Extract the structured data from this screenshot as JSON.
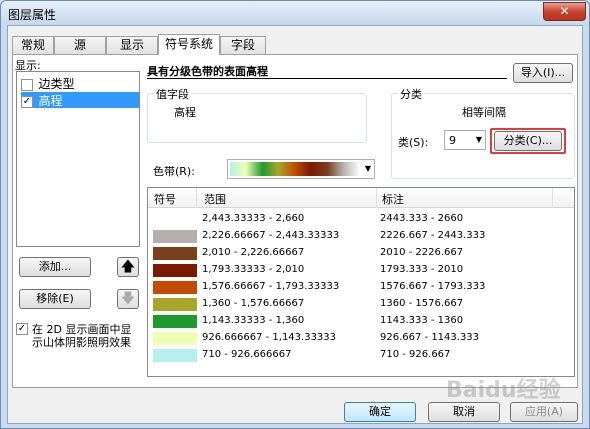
{
  "window": {
    "title": "图层属性",
    "close_glyph": "✕"
  },
  "tabs": [
    {
      "label": "常规"
    },
    {
      "label": "源"
    },
    {
      "label": "显示"
    },
    {
      "label": "符号系统",
      "active": true
    },
    {
      "label": "字段"
    }
  ],
  "left": {
    "show_label": "显示:",
    "items": [
      {
        "label": "边类型",
        "checked": false
      },
      {
        "label": "高程",
        "checked": true,
        "selected": true
      }
    ],
    "add_button": "添加...",
    "remove_button": "移除(E)",
    "up_glyph": "🡅",
    "down_glyph": "🡇",
    "hillshade_text_1": "在 2D 显示画面中显",
    "hillshade_text_2": "示山体阴影照明效果",
    "hillshade_checked": true
  },
  "right": {
    "renderer_title": "具有分级色带的表面高程",
    "import_button": "导入(I)...",
    "value_group_label": "值字段",
    "value_field": "高程",
    "class_group_label": "分类",
    "class_method": "相等间隔",
    "class_count_label": "类(S):",
    "class_count": "9",
    "classify_button": "分类(C)...",
    "color_ramp_label": "色带(R):"
  },
  "table": {
    "headers": [
      "符号",
      "范围",
      "标注"
    ],
    "rows": [
      {
        "color": "#ffffff",
        "range": "2,443.33333 - 2,660",
        "label": "2443.333 - 2660"
      },
      {
        "color": "#b4b0ae",
        "range": "2,226.66667 - 2,443.33333",
        "label": "2226.667 - 2443.333"
      },
      {
        "color": "#7c3f1d",
        "range": "2,010 - 2,226.66667",
        "label": "2010 - 2226.667"
      },
      {
        "color": "#7a1a02",
        "range": "1,793.33333 - 2,010",
        "label": "1793.333 - 2010"
      },
      {
        "color": "#c24b05",
        "range": "1,576.66667 - 1,793.33333",
        "label": "1576.667 - 1793.333"
      },
      {
        "color": "#a8a62a",
        "range": "1,360 - 1,576.66667",
        "label": "1360 - 1576.667"
      },
      {
        "color": "#1e9a2c",
        "range": "1,143.33333 - 1,360",
        "label": "1143.333 - 1360"
      },
      {
        "color": "#eeffb4",
        "range": "926.666667 - 1,143.33333",
        "label": "926.667 - 1143.333"
      },
      {
        "color": "#b5f1ec",
        "range": "710 - 926.666667",
        "label": "710 - 926.667"
      }
    ]
  },
  "footer": {
    "ok": "确定",
    "cancel": "取消",
    "apply": "应用(A)"
  },
  "watermark": "Baidu经验"
}
